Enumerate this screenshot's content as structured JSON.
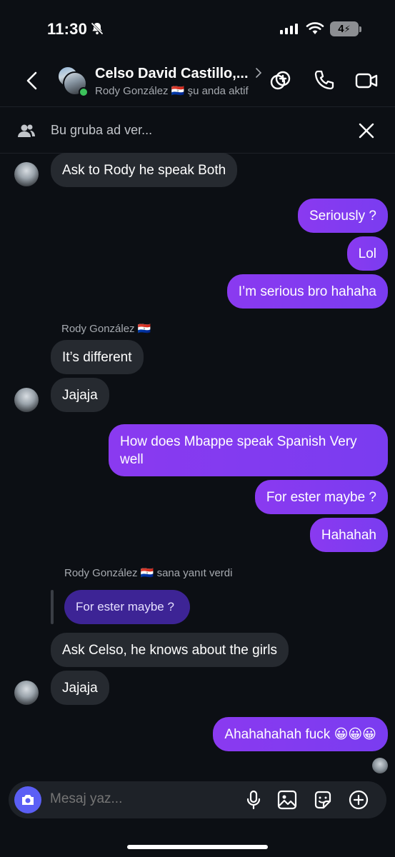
{
  "status_bar": {
    "time": "11:30",
    "battery": "4"
  },
  "header": {
    "title": "Celso David Castillo,...",
    "subtitle": "Rody González 🇵🇾 şu anda aktif"
  },
  "group_bar": {
    "placeholder": "Bu gruba ad ver..."
  },
  "messages": {
    "m1": "Ask to Rody he speak Both",
    "m2": "Seriously ?",
    "m3": "Lol",
    "m4": "I’m serious bro hahaha",
    "sender1": "Rody González 🇵🇾",
    "m5": "It’s different",
    "m6": "Jajaja",
    "m7": "How does Mbappe speak Spanish Very well",
    "m8": "For ester maybe ?",
    "m9": "Hahahah",
    "sender2": "Rody González 🇵🇾 sana yanıt verdi",
    "reply_quote": "For ester maybe ?",
    "m10": "Ask Celso, he knows about the girls",
    "m11": "Jajaja",
    "m12": "Ahahahahah fuck 😀😀😀"
  },
  "composer": {
    "placeholder": "Mesaj yaz..."
  },
  "colors": {
    "accent": "#7f3af0",
    "camera": "#5b5ff5",
    "online": "#3cc25b"
  },
  "icons": [
    "bell-off-icon",
    "signal-icon",
    "wifi-icon",
    "battery-icon",
    "back-icon",
    "add-people-icon",
    "phone-icon",
    "video-icon",
    "group-icon",
    "close-icon",
    "camera-icon",
    "microphone-icon",
    "gallery-icon",
    "sticker-icon",
    "plus-icon"
  ]
}
